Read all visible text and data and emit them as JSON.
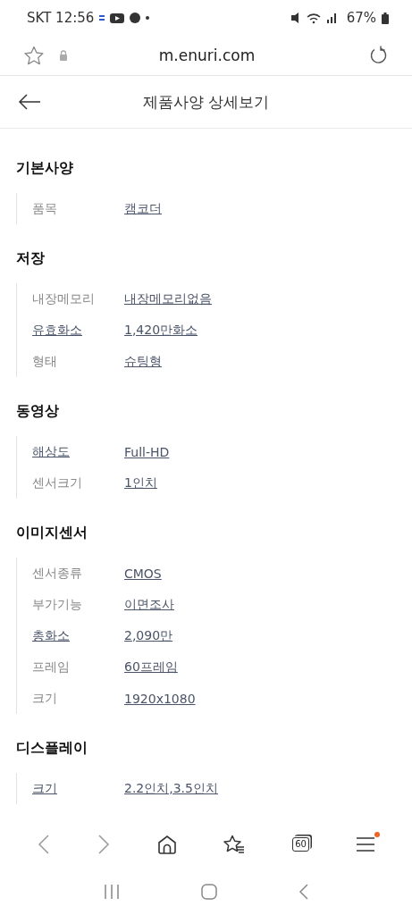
{
  "status_bar": {
    "carrier_time": "SKT 12:56",
    "battery": "67%"
  },
  "browser_bar": {
    "url": "m.enuri.com"
  },
  "header": {
    "title": "제품사양 상세보기"
  },
  "sections": [
    {
      "title": "기본사양",
      "rows": [
        {
          "label": "품목",
          "value": "캠코더",
          "label_link": false
        }
      ]
    },
    {
      "title": "저장",
      "rows": [
        {
          "label": "내장메모리",
          "value": "내장메모리없음",
          "label_link": false
        },
        {
          "label": "유효화소",
          "value": "1,420만화소",
          "label_link": true
        },
        {
          "label": "형태",
          "value": "슈팅형",
          "label_link": false
        }
      ]
    },
    {
      "title": "동영상",
      "rows": [
        {
          "label": "해상도",
          "value": "Full-HD",
          "label_link": true
        },
        {
          "label": "센서크기",
          "value": "1인치",
          "label_link": false
        }
      ]
    },
    {
      "title": "이미지센서",
      "rows": [
        {
          "label": "센서종류",
          "value": "CMOS",
          "label_link": false
        },
        {
          "label": "부가기능",
          "value": "이면조사",
          "label_link": false
        },
        {
          "label": "총화소",
          "value": "2,090만",
          "label_link": true
        },
        {
          "label": "프레임",
          "value": "60프레임",
          "label_link": false
        },
        {
          "label": "크기",
          "value": "1920x1080",
          "label_link": false
        }
      ]
    },
    {
      "title": "디스플레이",
      "rows": [
        {
          "label": "크기",
          "value": "2.2인치,3.5인치",
          "label_link": true
        }
      ]
    }
  ],
  "bottom_toolbar": {
    "tab_count": "60",
    "menu_badge": true
  }
}
